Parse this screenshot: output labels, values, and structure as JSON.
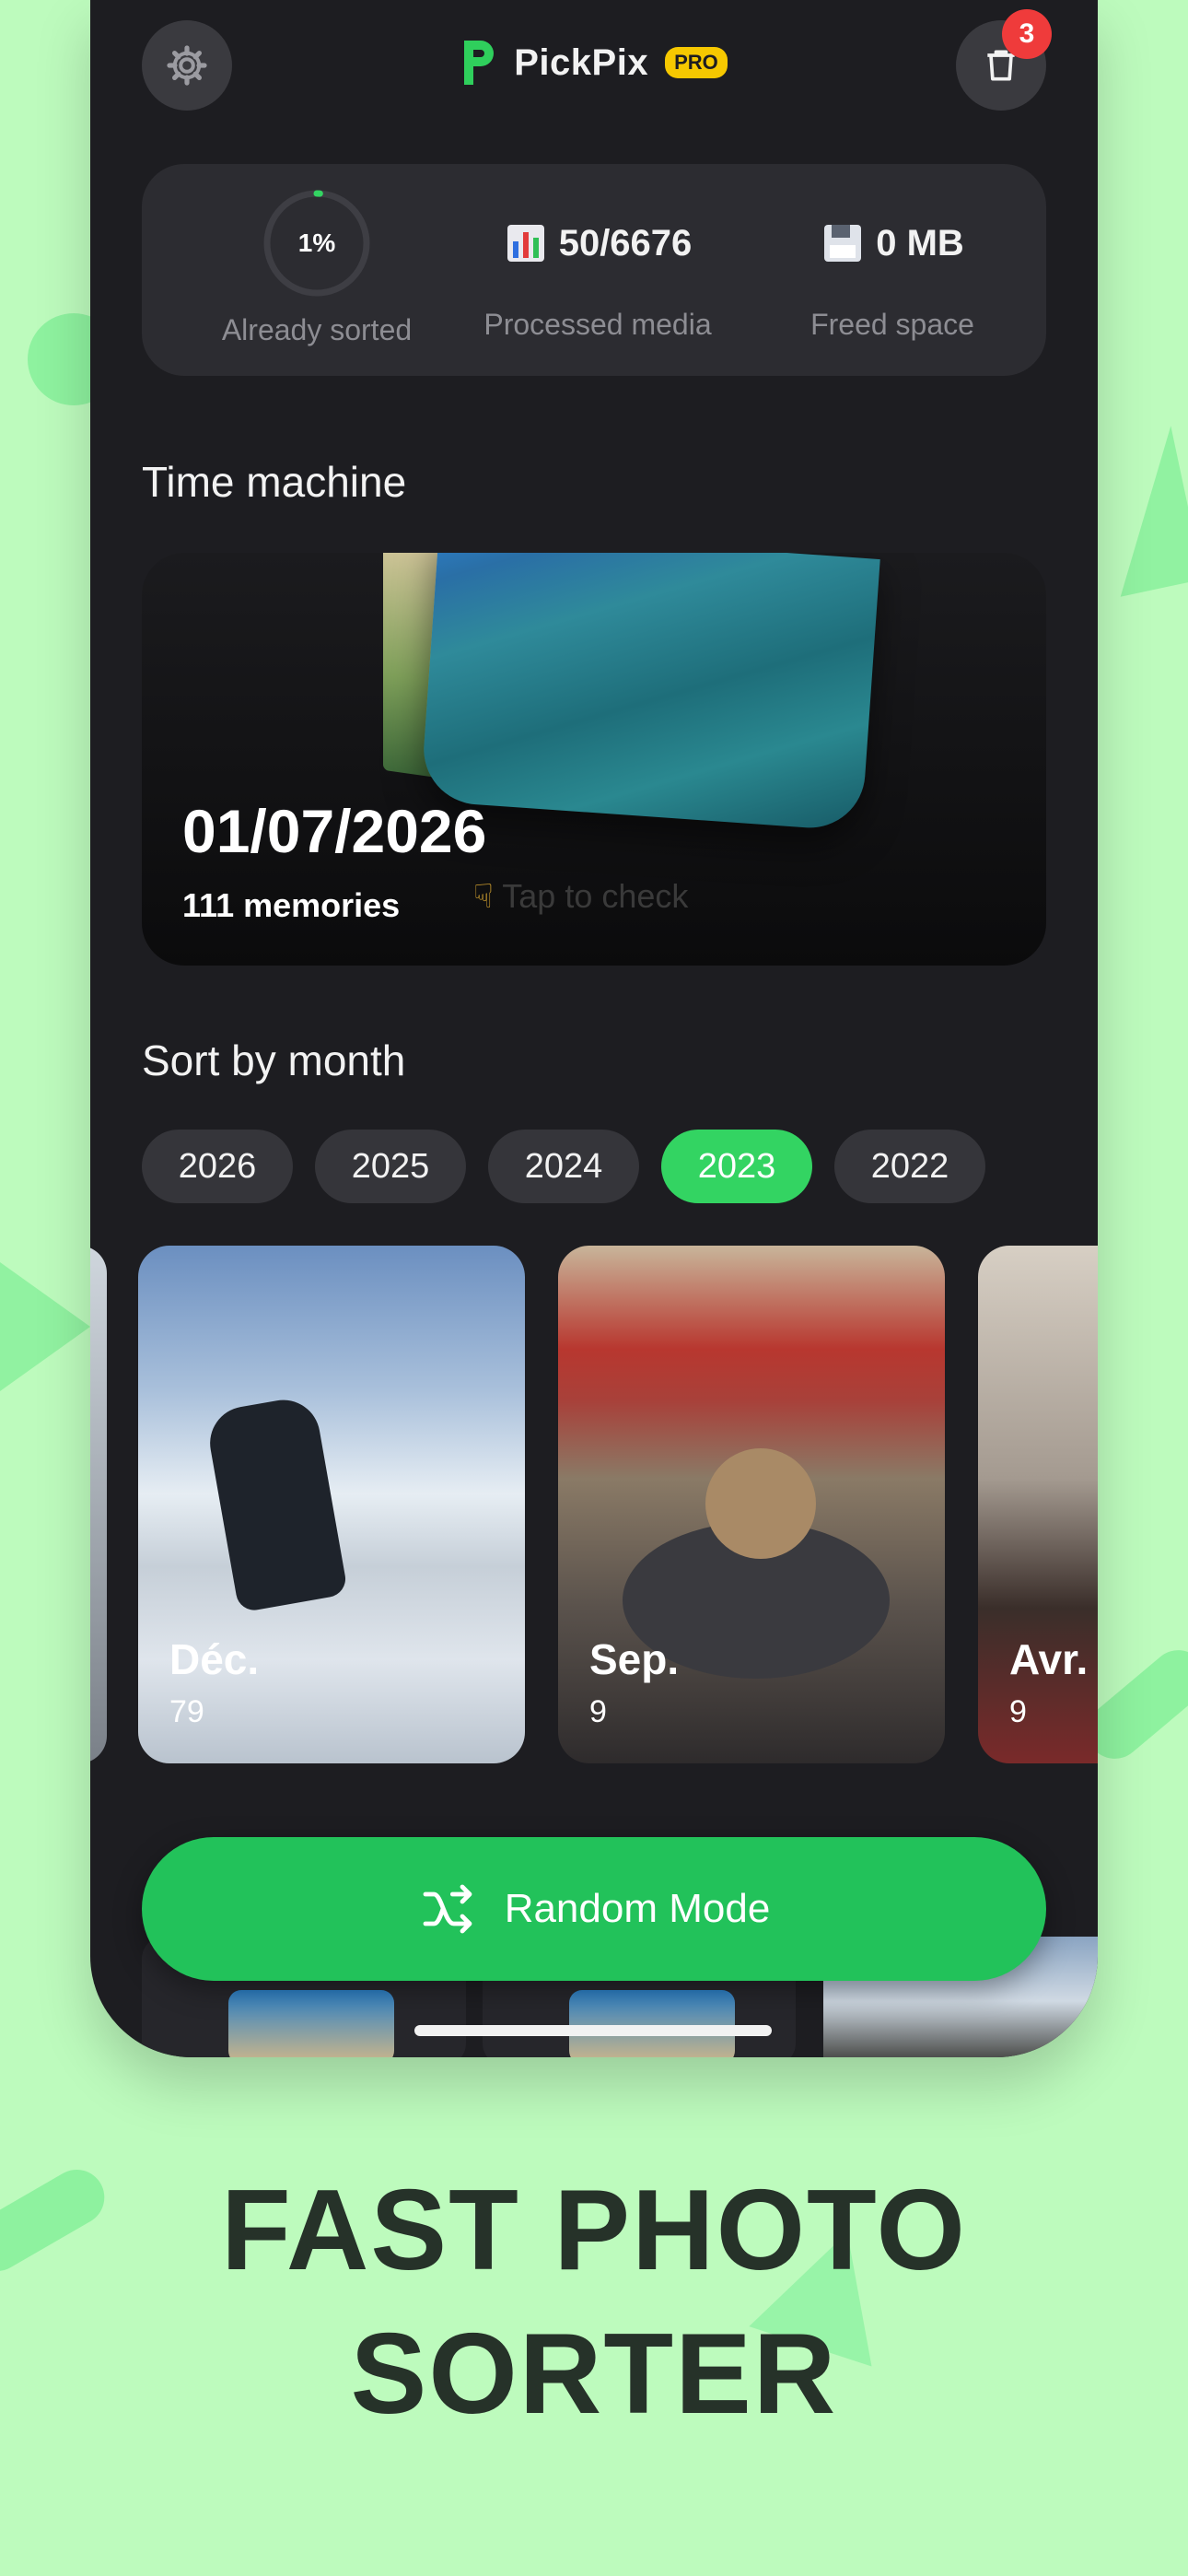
{
  "app": {
    "name": "PickPix",
    "pro_badge": "PRO",
    "trash_badge_count": "3"
  },
  "stats": {
    "sorted_percent": "1%",
    "sorted_fraction": 0.01,
    "sorted_caption": "Already sorted",
    "processed_value": "50/6676",
    "processed_caption": "Processed media",
    "freed_value": "0 MB",
    "freed_caption": "Freed space"
  },
  "time_machine": {
    "title": "Time machine",
    "date": "01/07/2026",
    "memories": "111 memories",
    "tap_hint": "Tap to check"
  },
  "sort_by_month": {
    "title": "Sort by month",
    "years": [
      {
        "label": "2026",
        "active": false
      },
      {
        "label": "2025",
        "active": false
      },
      {
        "label": "2024",
        "active": false
      },
      {
        "label": "2023",
        "active": true
      },
      {
        "label": "2022",
        "active": false
      }
    ],
    "months": [
      {
        "label": "Déc.",
        "count": "79"
      },
      {
        "label": "Sep.",
        "count": "9"
      },
      {
        "label": "Avr.",
        "count": "9"
      }
    ]
  },
  "random_button": {
    "label": "Random Mode"
  },
  "promo": {
    "line1": "FAST PHOTO",
    "line2": "SORTER"
  },
  "colors": {
    "background": "#bdfbbd",
    "accent_green": "#22c25a",
    "chip_active": "#33d462",
    "badge_red": "#ef3b3b",
    "pro_yellow": "#f6c800"
  }
}
